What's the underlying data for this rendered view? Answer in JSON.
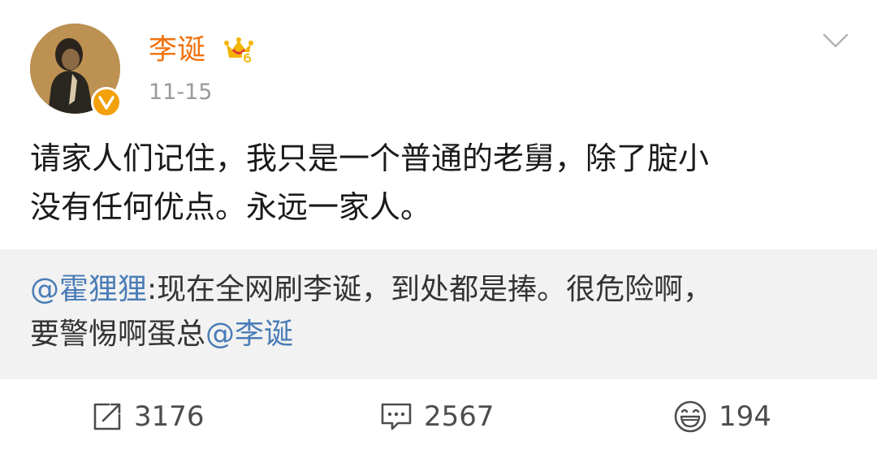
{
  "header": {
    "username": "李诞",
    "date": "11-15"
  },
  "post": {
    "text_line1": "请家人们记住，我只是一个普通的老舅，除了腚小",
    "text_line2": "没有任何优点。永远一家人。"
  },
  "repost": {
    "mention1": "@霍狸狸",
    "text1": ":现在全网刷李诞，到处都是捧。很危险啊，",
    "text2": "要警惕啊蛋总",
    "mention2": "@李诞"
  },
  "actions": {
    "share_count": "3176",
    "comment_count": "2567",
    "like_count": "194"
  },
  "colors": {
    "username": "#f0720e",
    "link": "#4a7db7",
    "repost_bg": "#f2f2f2"
  }
}
